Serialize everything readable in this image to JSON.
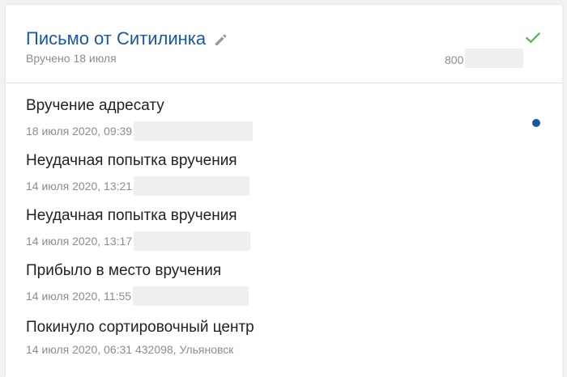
{
  "shipment": {
    "title": "Письмо от Ситилинка",
    "subtitle": "Вручено 18 июля",
    "tracking_prefix": "800",
    "status_icon": "check-icon",
    "edit_icon": "pencil-icon"
  },
  "colors": {
    "accent": "#1a57a5",
    "success": "#5cb85c",
    "muted": "#8c8c8c"
  },
  "events": [
    {
      "title": "Вручение адресату",
      "meta": "18 июля 2020, 09:39",
      "current": true
    },
    {
      "title": "Неудачная попытка вручения",
      "meta": "14 июля 2020, 13:21",
      "current": false
    },
    {
      "title": "Неудачная попытка вручения",
      "meta": "14 июля 2020, 13:17",
      "current": false
    },
    {
      "title": "Прибыло в место вручения",
      "meta": "14 июля 2020, 11:55",
      "current": false
    },
    {
      "title": "Покинуло сортировочный центр",
      "meta": "14 июля 2020, 06:31 432098, Ульяновск",
      "current": false
    }
  ]
}
